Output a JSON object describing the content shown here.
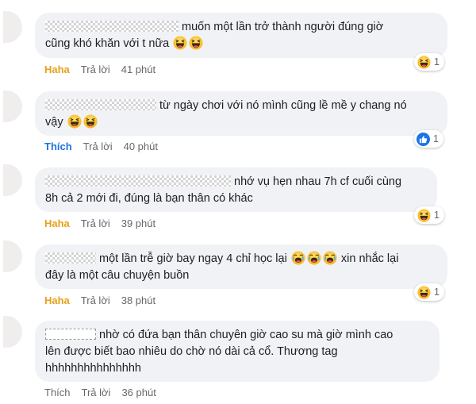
{
  "comments": [
    {
      "line1": "muốn một lần trở thành người đúng giờ",
      "line2": "cũng khó khăn với t nữa",
      "reaction_label": "Haha",
      "reply_label": "Trả lời",
      "time": "41 phút",
      "reaction_count": "1",
      "reaction_icon": "haha-emoji-icon"
    },
    {
      "line1": "từ ngày chơi với nó mình cũng lề mề y chang nó",
      "line2": "vậy",
      "reaction_label": "Thích",
      "reply_label": "Trả lời",
      "time": "40 phút",
      "reaction_count": "1",
      "reaction_icon": "like-thumb-icon"
    },
    {
      "line1": "nhớ vụ hẹn nhau 7h cf cuối cùng",
      "line2": "8h cả 2 mới đi, đúng là bạn thân có khác",
      "reaction_label": "Haha",
      "reply_label": "Trả lời",
      "time": "39 phút",
      "reaction_count": "1",
      "reaction_icon": "haha-emoji-icon"
    },
    {
      "line1a": "một lần trễ giờ bay ngay 4 chỉ học lại",
      "line1b": "xin nhắc lại",
      "line2": "đây là một câu chuyện buồn",
      "reaction_label": "Haha",
      "reply_label": "Trả lời",
      "time": "38 phút",
      "reaction_count": "1",
      "reaction_icon": "haha-emoji-icon"
    },
    {
      "line1": "nhờ có đứa bạn thân chuyên giờ cao su mà giờ mình cao",
      "line2": "lên được biết bao nhiêu do chờ nó dài cả cổ. Thương tag",
      "line3": "hhhhhhhhhhhhhhh",
      "reaction_label": "Thích",
      "reply_label": "Trả lời",
      "time": "36 phút"
    }
  ]
}
